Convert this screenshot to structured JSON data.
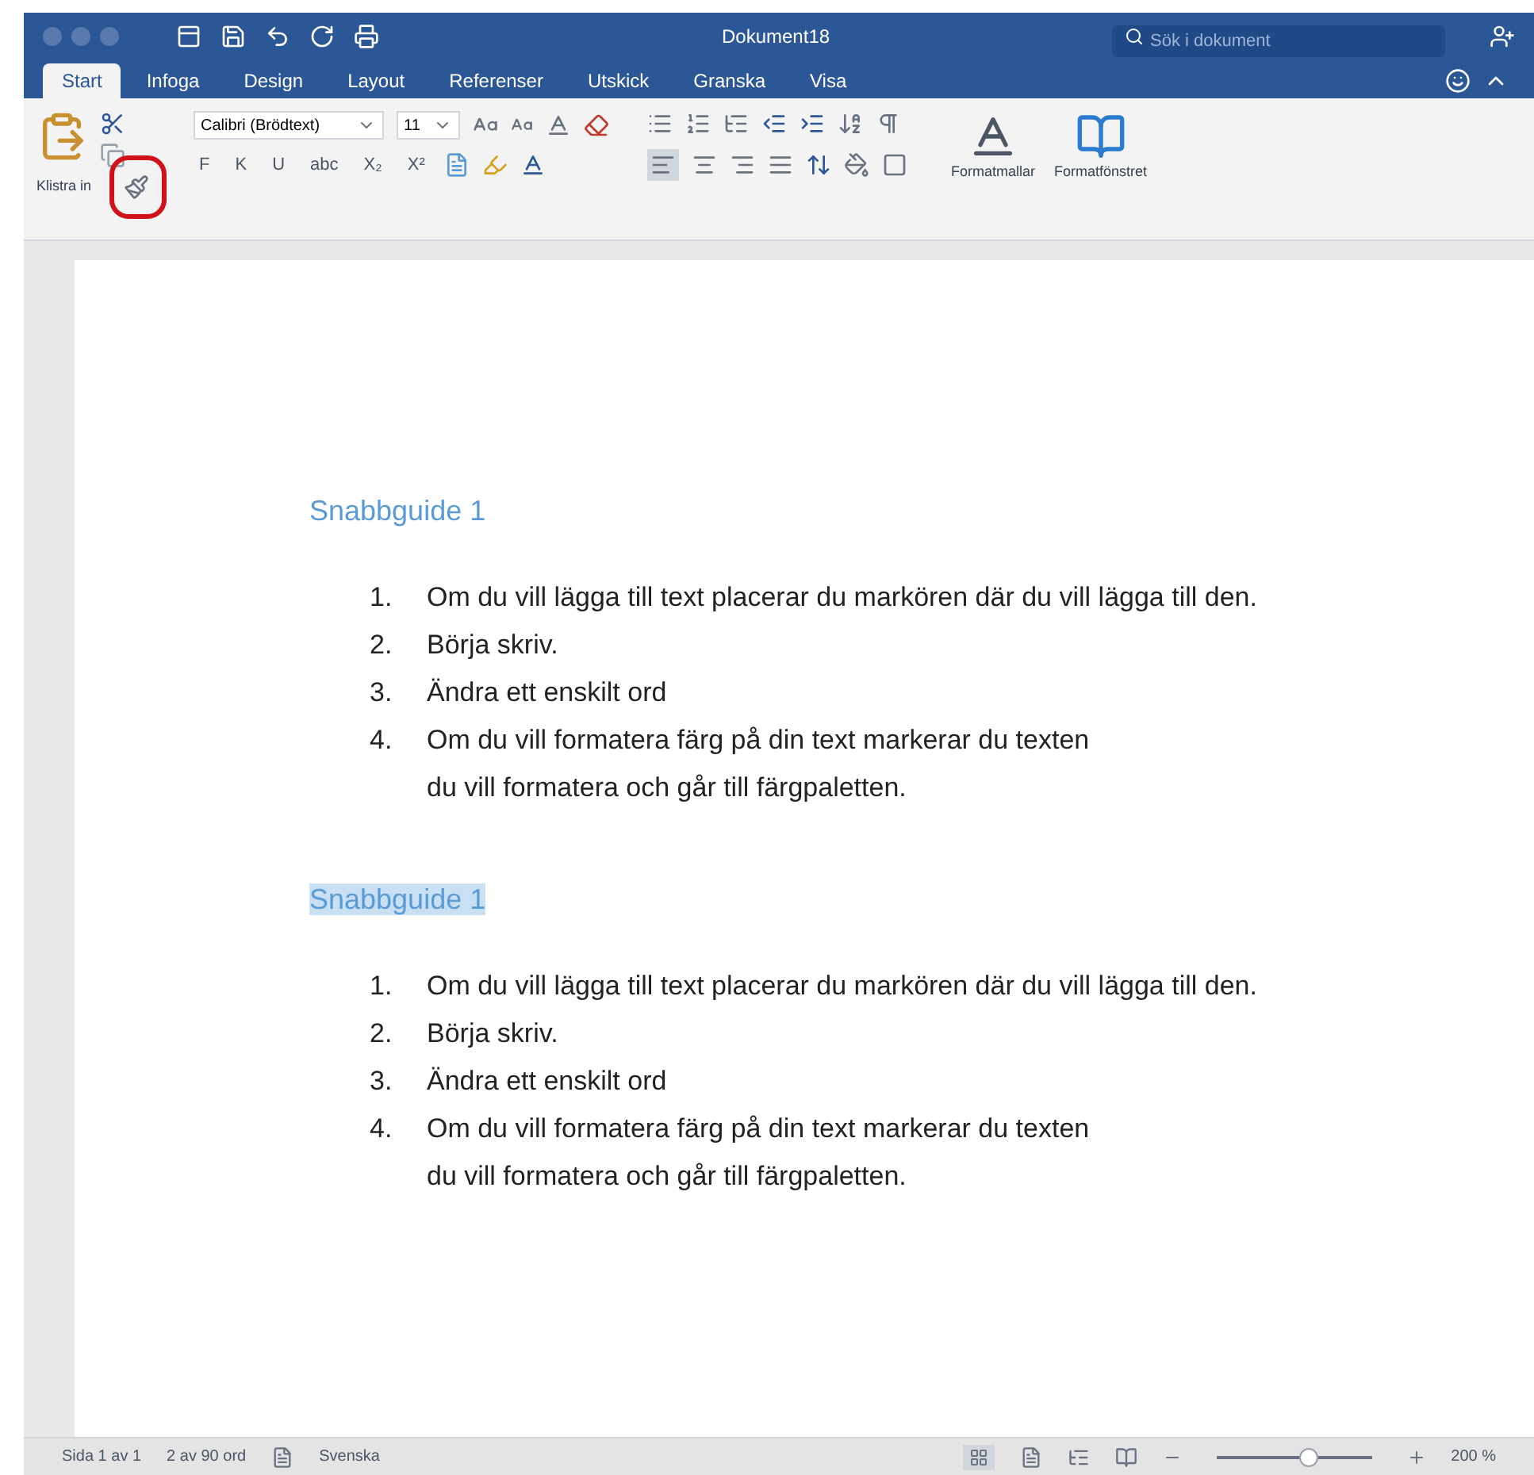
{
  "window": {
    "title": "Dokument18"
  },
  "search": {
    "placeholder": "Sök i dokument"
  },
  "tabs": [
    {
      "label": "Start",
      "selected": true
    },
    {
      "label": "Infoga",
      "selected": false
    },
    {
      "label": "Design",
      "selected": false
    },
    {
      "label": "Layout",
      "selected": false
    },
    {
      "label": "Referenser",
      "selected": false
    },
    {
      "label": "Utskick",
      "selected": false
    },
    {
      "label": "Granska",
      "selected": false
    },
    {
      "label": "Visa",
      "selected": false
    }
  ],
  "ribbon": {
    "paste_label": "Klistra in",
    "font_name": "Calibri (Brödtext)",
    "font_size": "11",
    "format_buttons": [
      "F",
      "K",
      "U",
      "abc",
      "X₂",
      "X²"
    ],
    "styles_label": "Formatmallar",
    "styles_pane_label": "Formatfönstret"
  },
  "sections": [
    {
      "heading": "Snabbguide 1",
      "selected": false,
      "items": [
        {
          "number": "1.",
          "lines": [
            "Om du vill lägga till text placerar du markören där du vill lägga till den."
          ]
        },
        {
          "number": "2.",
          "lines": [
            "Börja skriv."
          ]
        },
        {
          "number": "3.",
          "lines": [
            "Ändra ett enskilt ord"
          ]
        },
        {
          "number": "4.",
          "lines": [
            "Om du vill formatera färg på din text markerar du texten",
            "du vill formatera och går till färgpaletten."
          ]
        }
      ]
    },
    {
      "heading": "Snabbguide 1",
      "selected": true,
      "items": [
        {
          "number": "1.",
          "lines": [
            "Om du vill lägga till text placerar du markören där du vill lägga till den."
          ]
        },
        {
          "number": "2.",
          "lines": [
            "Börja skriv."
          ]
        },
        {
          "number": "3.",
          "lines": [
            "Ändra ett enskilt ord"
          ]
        },
        {
          "number": "4.",
          "lines": [
            "Om du vill formatera färg på din text markerar du texten",
            "du vill formatera och går till färgpaletten."
          ]
        }
      ]
    }
  ],
  "status_bar": {
    "page": "Sida 1 av 1",
    "words": "2 av 90 ord",
    "language": "Svenska",
    "zoom": "200 %",
    "zoom_slider": {
      "level": 0.6
    }
  }
}
